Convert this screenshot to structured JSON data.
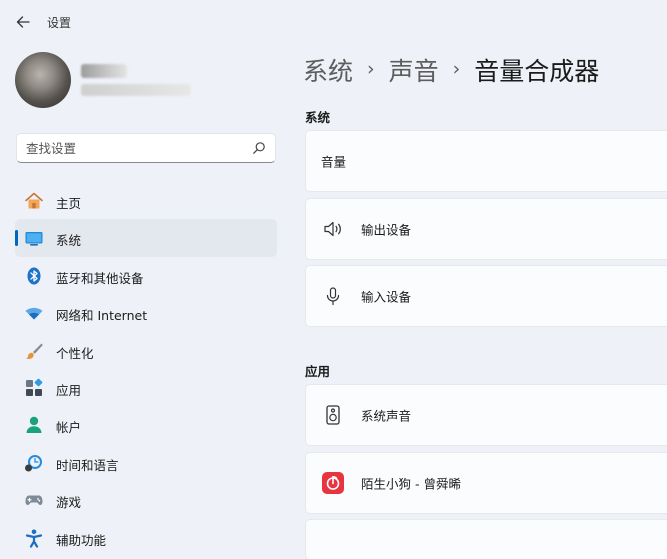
{
  "window": {
    "title": "设置"
  },
  "search": {
    "placeholder": "查找设置",
    "icon": "search-icon"
  },
  "sidebar": {
    "items": [
      {
        "label": "主页",
        "icon": "home-icon",
        "active": false
      },
      {
        "label": "系统",
        "icon": "system-display-icon",
        "active": true
      },
      {
        "label": "蓝牙和其他设备",
        "icon": "bluetooth-icon",
        "active": false
      },
      {
        "label": "网络和 Internet",
        "icon": "wifi-icon",
        "active": false
      },
      {
        "label": "个性化",
        "icon": "paintbrush-icon",
        "active": false
      },
      {
        "label": "应用",
        "icon": "apps-icon",
        "active": false
      },
      {
        "label": "帐户",
        "icon": "account-icon",
        "active": false
      },
      {
        "label": "时间和语言",
        "icon": "time-language-icon",
        "active": false
      },
      {
        "label": "游戏",
        "icon": "gamepad-icon",
        "active": false
      },
      {
        "label": "辅助功能",
        "icon": "accessibility-icon",
        "active": false
      }
    ]
  },
  "breadcrumb": {
    "items": [
      "系统",
      "声音"
    ],
    "current": "音量合成器",
    "separator": "›"
  },
  "main": {
    "sections": {
      "system": {
        "title": "系统",
        "volume_label": "音量",
        "output_label": "输出设备",
        "input_label": "输入设备"
      },
      "apps": {
        "title": "应用",
        "items": [
          {
            "label": "系统声音",
            "icon": "speaker-box-icon"
          },
          {
            "label": "陌生小狗 - 曾舜晞",
            "icon": "netease-music-icon"
          }
        ]
      }
    }
  },
  "colors": {
    "accent": "#0067c0",
    "background": "#eef2f8",
    "card": "#fbfcfd",
    "music_red": "#e8343f"
  }
}
